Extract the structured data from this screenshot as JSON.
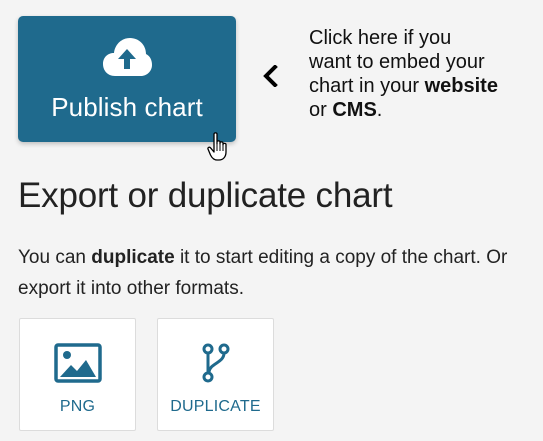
{
  "publish": {
    "label": "Publish chart",
    "icon": "cloud-upload-icon"
  },
  "hint": {
    "line1": "Click here if you",
    "line2": "want to embed your",
    "line3_prefix": "chart in your ",
    "line3_bold": "website",
    "line4_prefix": "or ",
    "line4_bold": "CMS",
    "line4_suffix": "."
  },
  "export": {
    "title": "Export or duplicate chart",
    "desc_prefix": "You can ",
    "desc_bold": "duplicate",
    "desc_suffix": " it to start editing a copy of the chart. Or export it into other formats.",
    "options": [
      {
        "label": "PNG",
        "icon": "image-icon"
      },
      {
        "label": "DUPLICATE",
        "icon": "fork-icon"
      }
    ]
  },
  "colors": {
    "accent": "#1f6a8d",
    "background": "#f4f4f4"
  }
}
